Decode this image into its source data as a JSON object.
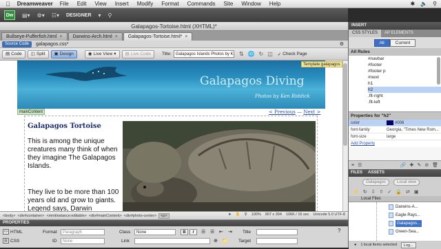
{
  "menubar": {
    "app_name": "Dreamweaver",
    "items": [
      "File",
      "Edit",
      "View",
      "Insert",
      "Modify",
      "Format",
      "Commands",
      "Site",
      "Window",
      "Help"
    ]
  },
  "app_toolbar": {
    "logo": "Dw",
    "workspace": "DESIGNER"
  },
  "document": {
    "window_title": "Galapagos-Tortoise.html (XHTML)*"
  },
  "tabs": [
    {
      "label": "Bullseye-Pufferfish.html"
    },
    {
      "label": "Darwins-Arch.html"
    },
    {
      "label": "Galapagos-Tortoise.html*"
    }
  ],
  "related_files": {
    "source_code": "Source Code",
    "css_file": "galapagos.css*"
  },
  "doc_toolbar": {
    "code": "Code",
    "split": "Split",
    "design": "Design",
    "live_view": "Live View",
    "live_code": "Live Code",
    "title_label": "Title:",
    "title_value": "Galapagos Islands Photos by Ke",
    "check_page": "Check Page"
  },
  "page": {
    "site_title": "Galapagos Diving",
    "byline": "Photos by Ken Riddick",
    "template_tag": "Template:galapagos",
    "main_content_tag": "mainContent",
    "nav_previous": "< Previous",
    "nav_sep": "—",
    "nav_next": "Next >",
    "heading": "Galapagos Tortoise",
    "para1": "This is among the unique creatures many think of when they imagine The Galapagos Islands.",
    "para2": "They live to be more than 100 years old and grow to giants. Legend says, Darwin"
  },
  "status_bar": {
    "tags": [
      "<body>",
      "<div#container>",
      "<mmtinstance:editable>",
      "<div#mainContent>",
      "<div#photo-center>",
      "<p>"
    ],
    "zoom": "100%",
    "dimensions": "907 x 394",
    "size": "106K / 16 sec",
    "encoding": "Unicode 5.0 UTF-8"
  },
  "properties": {
    "header": "PROPERTIES",
    "html_mode": "HTML",
    "css_mode": "CSS",
    "format_label": "Format",
    "format_value": "Paragraph",
    "id_label": "ID",
    "id_value": "None",
    "class_label": "Class",
    "class_value": "None",
    "link_label": "Link",
    "title_label": "Title",
    "target_label": "Target",
    "bold": "B",
    "italic": "I"
  },
  "right_panel": {
    "insert": "INSERT",
    "css_styles_tab": "CSS STYLES",
    "ap_elements_tab": "AP ELEMENTS",
    "all_btn": "All",
    "current_btn": "Current",
    "all_rules": "All Rules",
    "rules": [
      "#navbar",
      "#footer",
      "#footer p",
      "#next",
      "h1",
      "h2",
      ".flt-right",
      ".flt-left"
    ],
    "selected_rule_index": 5,
    "properties_for": "Properties for \"h2\"",
    "properties": [
      {
        "key": "color",
        "value": "#006",
        "swatch": "#000066"
      },
      {
        "key": "font-family",
        "value": "Georgia, \"Times New Rom..."
      },
      {
        "key": "font-size",
        "value": "large"
      }
    ],
    "add_property": "Add Property",
    "files_tab": "FILES",
    "assets_tab": "ASSETS",
    "site_dropdown": "Galapagos",
    "view_dropdown": "Local view",
    "local_files": "Local Files",
    "files": [
      "Darwins-A...",
      "Eagle-Rays...",
      "Galapagos...",
      "Green-Sea..."
    ],
    "selected_file_index": 2,
    "selection_status": "1 local items selected",
    "log_button": "Log..."
  }
}
